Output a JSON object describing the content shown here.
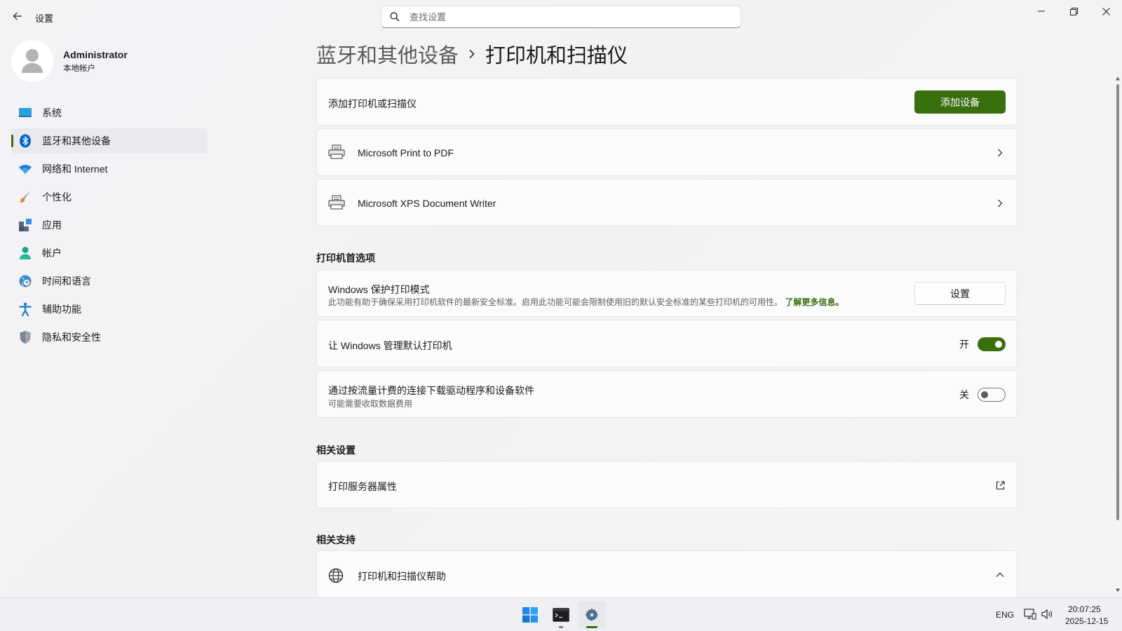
{
  "window": {
    "title": "设置",
    "search_placeholder": "查找设置"
  },
  "user": {
    "name": "Administrator",
    "account_type": "本地帐户"
  },
  "sidebar": {
    "items": [
      {
        "label": "系统",
        "icon": "system-icon"
      },
      {
        "label": "蓝牙和其他设备",
        "icon": "bluetooth-icon",
        "active": true
      },
      {
        "label": "网络和 Internet",
        "icon": "wifi-icon"
      },
      {
        "label": "个性化",
        "icon": "brush-icon"
      },
      {
        "label": "应用",
        "icon": "apps-icon"
      },
      {
        "label": "帐户",
        "icon": "account-icon"
      },
      {
        "label": "时间和语言",
        "icon": "time-language-icon"
      },
      {
        "label": "辅助功能",
        "icon": "accessibility-icon"
      },
      {
        "label": "隐私和安全性",
        "icon": "shield-icon"
      }
    ]
  },
  "breadcrumb": {
    "parent": "蓝牙和其他设备",
    "current": "打印机和扫描仪"
  },
  "add_printer": {
    "label": "添加打印机或扫描仪",
    "button": "添加设备"
  },
  "printers": [
    {
      "name": "Microsoft Print to PDF"
    },
    {
      "name": "Microsoft XPS Document Writer"
    }
  ],
  "preferences": {
    "heading": "打印机首选项",
    "protected_mode": {
      "title": "Windows 保护打印模式",
      "description": "此功能有助于确保采用打印机软件的最新安全标准。启用此功能可能会限制使用旧的默认安全标准的某些打印机的可用性。",
      "link": "了解更多信息。",
      "button": "设置"
    },
    "default_printer": {
      "title": "让 Windows 管理默认打印机",
      "state_label": "开",
      "on": true
    },
    "metered": {
      "title": "通过按流量计费的连接下载驱动程序和设备软件",
      "subtitle": "可能需要收取数据费用",
      "state_label": "关",
      "on": false
    }
  },
  "related_settings": {
    "heading": "相关设置",
    "items": [
      {
        "label": "打印服务器属性"
      }
    ]
  },
  "related_support": {
    "heading": "相关支持",
    "items": [
      {
        "label": "打印机和扫描仪帮助"
      }
    ]
  },
  "taskbar": {
    "language": "ENG",
    "time": "20:07:25",
    "date": "2025-12-15"
  },
  "colors": {
    "accent": "#3a6f0e",
    "bluetooth": "#0067c0"
  }
}
